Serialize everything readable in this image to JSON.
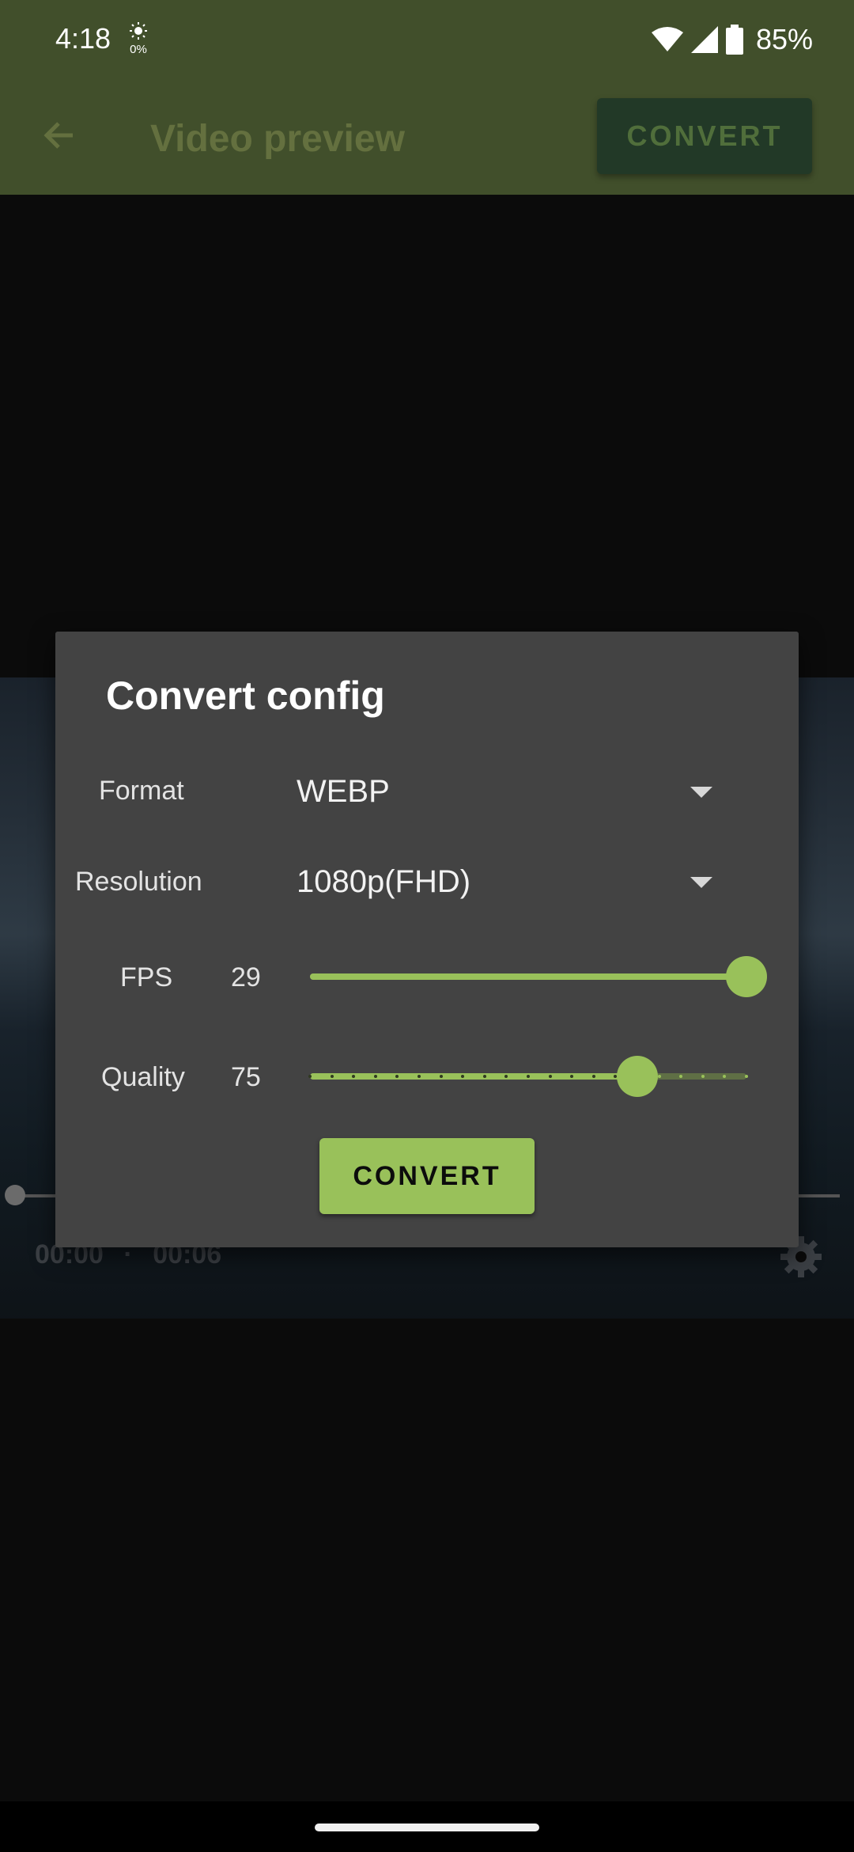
{
  "status_bar": {
    "time": "4:18",
    "sun_badge": "0%",
    "battery": "85%",
    "icons": [
      "sun-icon",
      "wifi-icon",
      "signal-icon",
      "battery-icon"
    ]
  },
  "app_bar": {
    "title": "Video preview",
    "convert_label": "CONVERT",
    "back_icon": "arrow-left-icon"
  },
  "player": {
    "current_time": "00:00",
    "separator": "·",
    "duration": "00:06",
    "settings_icon": "gear-icon",
    "progress_fraction": 0.0
  },
  "dialog": {
    "title": "Convert config",
    "format": {
      "label": "Format",
      "value": "WEBP"
    },
    "resolution": {
      "label": "Resolution",
      "value": "1080p(FHD)"
    },
    "fps": {
      "label": "FPS",
      "value": "29",
      "level": 1.0
    },
    "quality": {
      "label": "Quality",
      "value": "75",
      "level": 0.75
    },
    "convert_label": "CONVERT"
  },
  "colors": {
    "accent": "#99c15a",
    "app_bar": "#414f2b",
    "dialog_bg": "#434343"
  }
}
